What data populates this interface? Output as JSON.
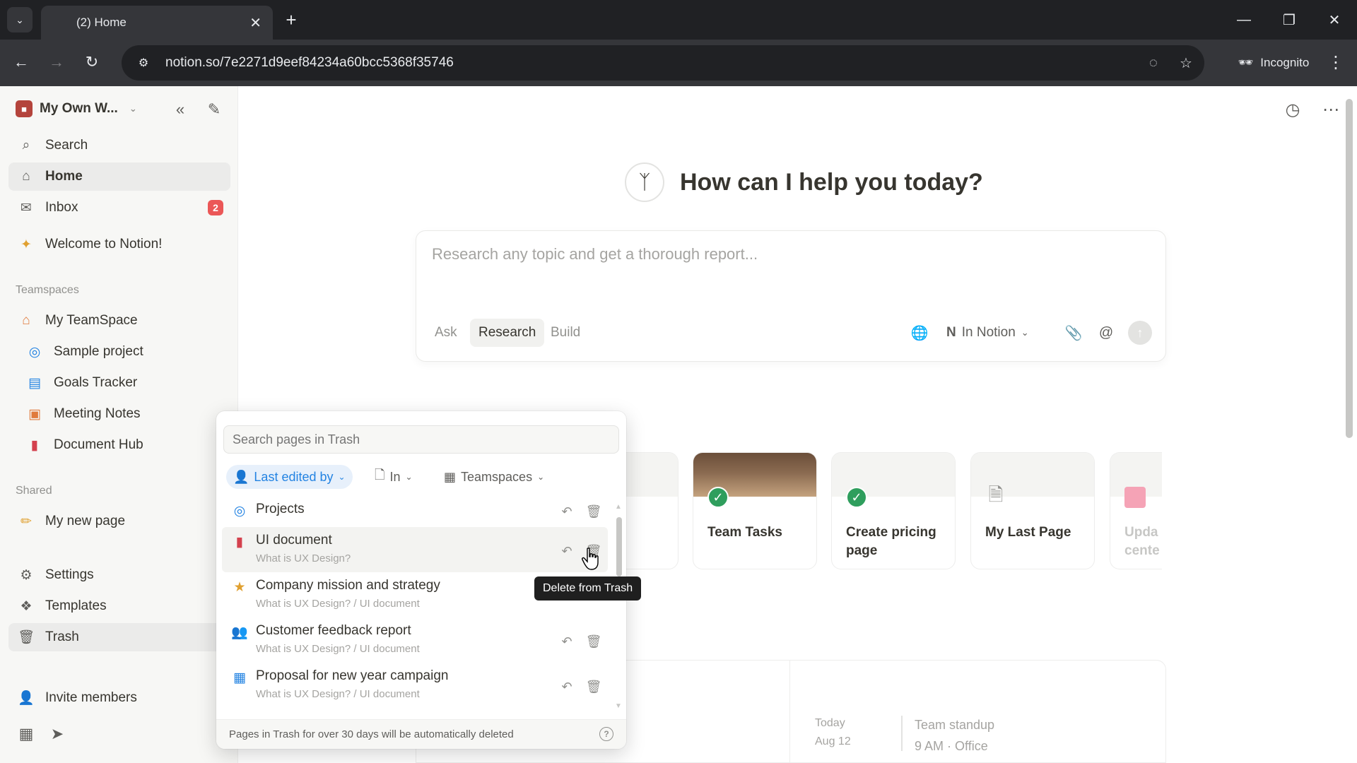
{
  "browser": {
    "tab_title": "(2) Home",
    "url": "notion.so/7e2271d9eef84234a60bcc5368f35746",
    "incognito_label": "Incognito"
  },
  "sidebar": {
    "workspace_name": "My Own W...",
    "nav": [
      {
        "label": "Search",
        "icon": "search-icon"
      },
      {
        "label": "Home",
        "icon": "home-icon"
      },
      {
        "label": "Inbox",
        "icon": "inbox-icon",
        "badge": "2"
      }
    ],
    "welcome_page": "Welcome to Notion!",
    "teamspaces_label": "Teamspaces",
    "teamspace": {
      "name": "My TeamSpace",
      "pages": [
        "Sample project",
        "Goals Tracker",
        "Meeting Notes",
        "Document Hub"
      ]
    },
    "shared_label": "Shared",
    "shared_pages": [
      "My new page"
    ],
    "bottom": [
      {
        "label": "Settings",
        "icon": "gear-icon"
      },
      {
        "label": "Templates",
        "icon": "templates-icon"
      },
      {
        "label": "Trash",
        "icon": "trash-icon"
      }
    ],
    "invite_label": "Invite members"
  },
  "assistant": {
    "greeting": "How can I help you today?",
    "placeholder": "Research any topic and get a thorough report...",
    "modes": [
      "Ask",
      "Research",
      "Build"
    ],
    "selected_mode": "Research",
    "scope_label": "In Notion"
  },
  "recent_cards": [
    {
      "title": "Team Tasks"
    },
    {
      "title": "Create pricing page"
    },
    {
      "title": "My Last Page"
    },
    {
      "title": "Upda cente"
    }
  ],
  "trash_popup": {
    "search_placeholder": "Search pages in Trash",
    "filters": [
      "Last edited by",
      "In",
      "Teamspaces"
    ],
    "items": [
      {
        "title": "Projects",
        "path": ""
      },
      {
        "title": "UI document",
        "path": "What is UX Design?"
      },
      {
        "title": "Company mission and strategy",
        "path": "What is UX Design? / UI document"
      },
      {
        "title": "Customer feedback report",
        "path": "What is UX Design? / UI document"
      },
      {
        "title": "Proposal for new year campaign",
        "path": "What is UX Design? / UI document"
      }
    ],
    "footer_note": "Pages in Trash for over 30 days will be automatically deleted",
    "tooltip": "Delete from Trash"
  },
  "calendar_preview": {
    "day": "Today",
    "date": "Aug 12",
    "event_title": "Team standup",
    "event_detail": "9 AM · Office"
  },
  "colors": {
    "accent": "#2383e2",
    "badge": "#eb5757",
    "sidebar_bg": "#f7f7f5",
    "check_green": "#2f9e5d"
  }
}
